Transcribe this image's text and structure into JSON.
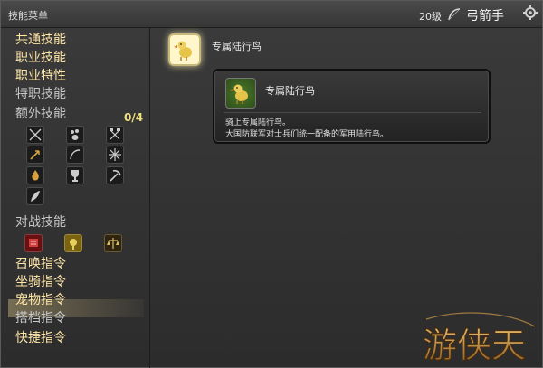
{
  "window": {
    "title": "技能菜单",
    "level": "20级",
    "job_name": "弓箭手"
  },
  "sidebar": {
    "items": [
      {
        "label": "共通技能"
      },
      {
        "label": "职业技能"
      },
      {
        "label": "职业特性"
      },
      {
        "label": "特职技能"
      },
      {
        "label": "额外技能"
      },
      {
        "label": "对战技能"
      },
      {
        "label": "召唤指令"
      },
      {
        "label": "坐骑指令"
      },
      {
        "label": "宠物指令"
      },
      {
        "label": "搭档指令"
      },
      {
        "label": "快捷指令"
      }
    ],
    "extra_count": "0/4",
    "selected_item": "坐骑指令"
  },
  "main": {
    "skill_name": "专属陆行鸟",
    "tooltip": {
      "name": "专属陆行鸟",
      "desc_line1": "骑上专属陆行鸟。",
      "desc_line2": "大国防联军对士兵们统一配备的军用陆行鸟。"
    }
  },
  "watermark": {
    "text": "游侠天"
  },
  "colors": {
    "accent_text": "#ffe7a8",
    "count": "#f0e080"
  }
}
